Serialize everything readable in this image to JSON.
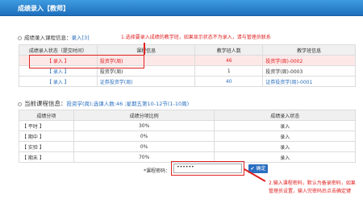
{
  "window": {
    "title": "成绩录入【教师】"
  },
  "course_section": {
    "heading": "成绩录入课程信息：",
    "link": "录入[3]",
    "hint": "1.选择要录入成绩的教学班，如果显示状态不为录入，请与管理员联系",
    "columns": [
      "成绩录入状态（提交时间）",
      "课程信息",
      "教学班人数",
      "教学班信息"
    ],
    "rows": [
      {
        "status": "【 录入 】",
        "course": "投资学(周)",
        "count": "46",
        "class_info": "投资学(周)-0002"
      },
      {
        "status": "【 录入 】",
        "course": "投资学(周)",
        "count": "1",
        "class_info": "投资学(周)-0003"
      },
      {
        "status": "【 录入 】",
        "course": "证券投资学(周)",
        "count": "40",
        "class_info": "证券投资学(周)-0001"
      }
    ]
  },
  "current_section": {
    "heading": "当前课程信息：",
    "info": "投资学(周);选课人数:46 ;星期五第10-12节(1-10周)",
    "columns": [
      "成绩分项",
      "成绩分项比例",
      "成绩录入状态"
    ],
    "rows": [
      {
        "item": "【 平时 】",
        "ratio": "30%",
        "state": "录入"
      },
      {
        "item": "【 期中 】",
        "ratio": "0%",
        "state": "录入"
      },
      {
        "item": "【 实验 】",
        "ratio": "0%",
        "state": "录入"
      },
      {
        "item": "【 期末 】",
        "ratio": "70%",
        "state": "录入"
      }
    ]
  },
  "password": {
    "label": "*课程密码：",
    "value": "••••••",
    "button": "✔ 确定",
    "hint_line1": "2.输入课程密码，默认为备录密码，如果",
    "hint_line2": "管理员设置，输入完密码后点击确定键"
  }
}
